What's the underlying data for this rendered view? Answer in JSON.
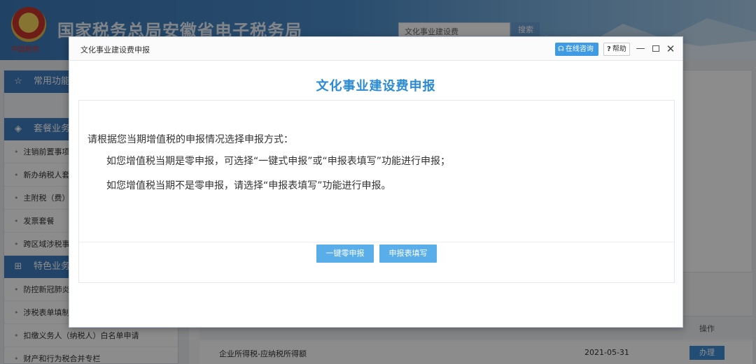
{
  "background": {
    "site": {
      "emblem_caption": "中国税务",
      "title": "国家税务总局安徽省电子税务局",
      "search_placeholder": "文化事业建设费",
      "search_button": "搜索"
    },
    "sidebar": {
      "sections": [
        {
          "icon": "star-icon",
          "label": "常用功能"
        },
        {
          "icon": "layers-icon",
          "label": "套餐业务"
        },
        {
          "icon": "grid-icon",
          "label": "特色业务"
        }
      ],
      "package_items": [
        "注销前置事项",
        "新办纳税人套餐",
        "主附税（费）",
        "发票套餐",
        "跨区域涉税事项"
      ],
      "special_items": [
        "防控新冠肺炎",
        "涉税表单填制",
        "扣缴义务人（纳税人）白名单申请",
        "财产和行为税合并专栏"
      ]
    },
    "table": {
      "header_action": "操作",
      "row": {
        "name": "企业所得税-应纳税所得额",
        "date": "2021-05-31",
        "action": "办理"
      }
    }
  },
  "dialog": {
    "window_title": "文化事业建设费申报",
    "consult_label": "在线咨询",
    "help_label": "帮助",
    "heading": "文化事业建设费申报",
    "intro": "请根据您当期增值税的申报情况选择申报方式：",
    "line1": "如您增值税当期是零申报，可选择“一键式申报”或“申报表填写”功能进行申报；",
    "line2": "如您增值税当期不是零申报，请选择“申报表填写”功能进行申报。",
    "button_zero": "一键零申报",
    "button_fill": "申报表填写"
  },
  "colors": {
    "accent": "#2a8ad3",
    "button": "#59aeea",
    "sidebar_header": "#3f7cc0",
    "overlay": "rgba(0,0,0,0.45)"
  }
}
